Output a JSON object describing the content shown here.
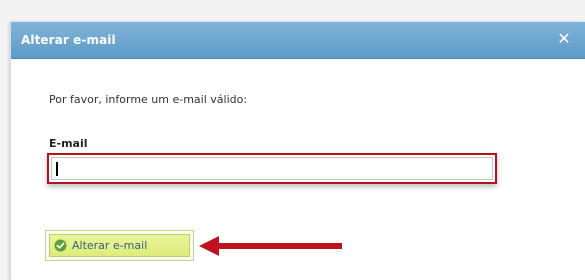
{
  "dialog": {
    "title": "Alterar e-mail",
    "close_icon": "close-icon"
  },
  "form": {
    "prompt": "Por favor, informe um e-mail válido:",
    "email_label": "E-mail",
    "email_value": "",
    "email_placeholder": ""
  },
  "actions": {
    "submit_label": "Alterar e-mail",
    "submit_icon": "check-circle-icon"
  },
  "annotations": {
    "arrow_icon": "left-arrow-icon"
  },
  "colors": {
    "titlebar": "#6fa8d2",
    "input_highlight": "#b5121b",
    "button": "#e2ef86",
    "arrow": "#c1121f"
  }
}
